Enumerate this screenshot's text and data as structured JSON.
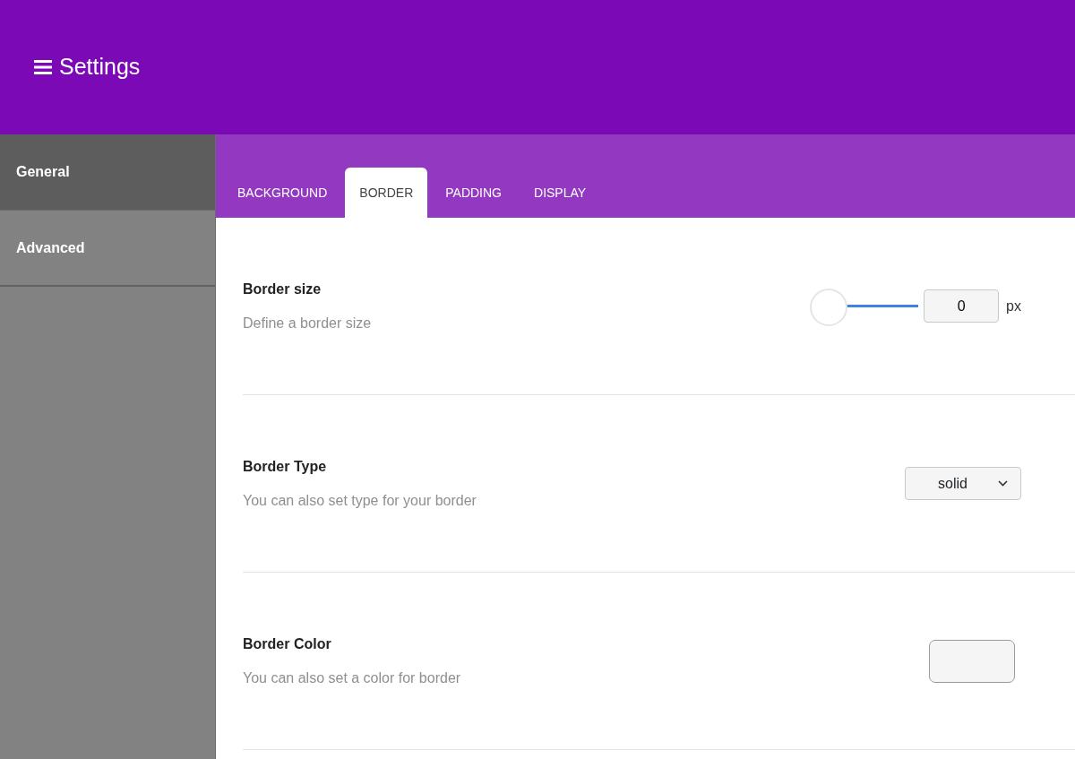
{
  "header": {
    "title": "Settings"
  },
  "sidebar": {
    "items": [
      {
        "label": "General",
        "selected": true
      },
      {
        "label": "Advanced",
        "selected": false
      }
    ]
  },
  "tabs": [
    {
      "label": "BACKGROUND",
      "selected": false
    },
    {
      "label": "BORDER",
      "selected": true
    },
    {
      "label": "PADDING",
      "selected": false
    },
    {
      "label": "DISPLAY",
      "selected": false
    }
  ],
  "settings": [
    {
      "kind": "slider",
      "title": "Border size",
      "description": "Define a border size",
      "level": 0,
      "value": "0",
      "unit": "px"
    },
    {
      "kind": "select",
      "title": "Border Type",
      "description": "You can also set type for your border",
      "value": "solid"
    },
    {
      "kind": "color",
      "title": "Border Color",
      "description": "You can also set a color for border"
    }
  ]
}
